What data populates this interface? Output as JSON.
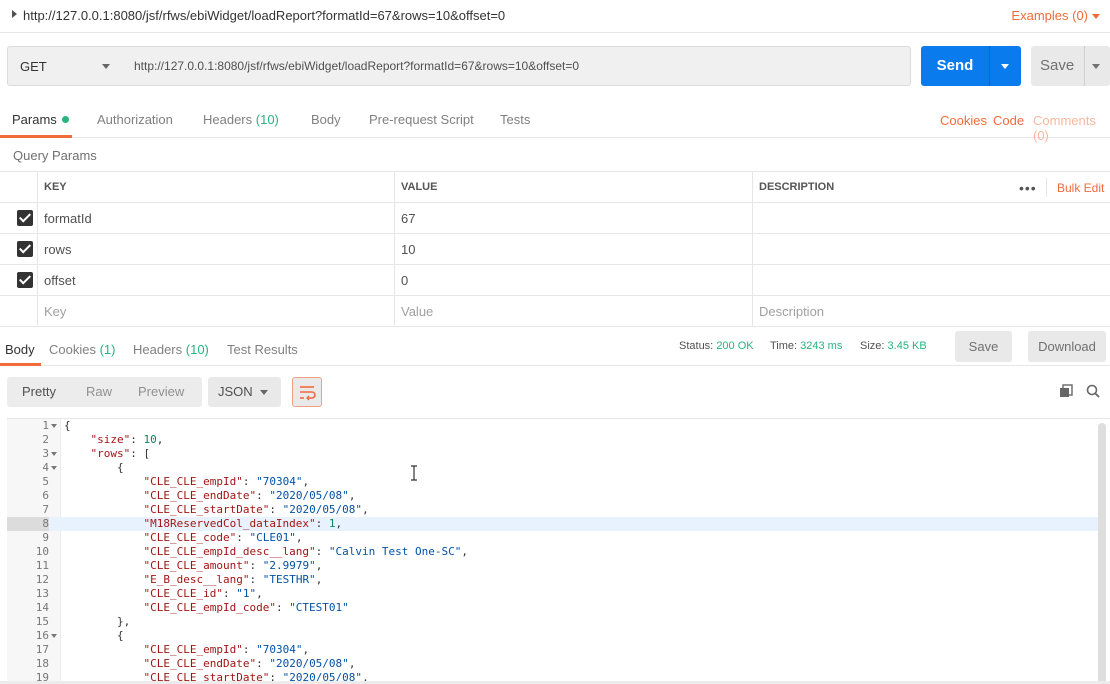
{
  "titlebar": {
    "title": "http://127.0.0.1:8080/jsf/rfws/ebiWidget/loadReport?formatId=67&rows=10&offset=0",
    "examples": "Examples (0)"
  },
  "request": {
    "method": "GET",
    "url": "http://127.0.0.1:8080/jsf/rfws/ebiWidget/loadReport?formatId=67&rows=10&offset=0",
    "send_label": "Send",
    "save_label": "Save"
  },
  "request_tabs": {
    "params": "Params",
    "authorization": "Authorization",
    "headers": "Headers",
    "headers_count": "(10)",
    "body": "Body",
    "prerequest": "Pre-request Script",
    "tests": "Tests",
    "cookies": "Cookies",
    "code": "Code",
    "comments": "Comments (0)"
  },
  "params": {
    "section_label": "Query Params",
    "columns": {
      "key": "KEY",
      "value": "VALUE",
      "description": "DESCRIPTION"
    },
    "more": "•••",
    "bulk_edit": "Bulk Edit",
    "rows": [
      {
        "key": "formatId",
        "value": "67",
        "checked": true
      },
      {
        "key": "rows",
        "value": "10",
        "checked": true
      },
      {
        "key": "offset",
        "value": "0",
        "checked": true
      }
    ],
    "placeholders": {
      "key": "Key",
      "value": "Value",
      "description": "Description"
    }
  },
  "response_tabs": {
    "body": "Body",
    "cookies": "Cookies",
    "cookies_count": "(1)",
    "headers": "Headers",
    "headers_count": "(10)",
    "test_results": "Test Results"
  },
  "response_status": {
    "status_label": "Status:",
    "status_value": "200 OK",
    "time_label": "Time:",
    "time_value": "3243 ms",
    "size_label": "Size:",
    "size_value": "3.45 KB",
    "save_label": "Save",
    "download_label": "Download"
  },
  "viewer": {
    "modes": [
      "Pretty",
      "Raw",
      "Preview"
    ],
    "format": "JSON"
  },
  "code_lines": [
    {
      "n": "1",
      "fold": true,
      "text": "{"
    },
    {
      "n": "2",
      "text": "    \"size\": 10,"
    },
    {
      "n": "3",
      "fold": true,
      "text": "    \"rows\": ["
    },
    {
      "n": "4",
      "fold": true,
      "text": "        {"
    },
    {
      "n": "5",
      "text": "            \"CLE_CLE_empId\": \"70304\","
    },
    {
      "n": "6",
      "text": "            \"CLE_CLE_endDate\": \"2020/05/08\","
    },
    {
      "n": "7",
      "text": "            \"CLE_CLE_startDate\": \"2020/05/08\","
    },
    {
      "n": "8",
      "text": "            \"M18ReservedCol_dataIndex\": 1,",
      "highlight": true
    },
    {
      "n": "9",
      "text": "            \"CLE_CLE_code\": \"CLE01\","
    },
    {
      "n": "10",
      "text": "            \"CLE_CLE_empId_desc__lang\": \"Calvin Test One-SC\","
    },
    {
      "n": "11",
      "text": "            \"CLE_CLE_amount\": \"2.9979\","
    },
    {
      "n": "12",
      "text": "            \"E_B_desc__lang\": \"TESTHR\","
    },
    {
      "n": "13",
      "text": "            \"CLE_CLE_id\": \"1\","
    },
    {
      "n": "14",
      "text": "            \"CLE_CLE_empId_code\": \"CTEST01\""
    },
    {
      "n": "15",
      "text": "        },"
    },
    {
      "n": "16",
      "fold": true,
      "text": "        {"
    },
    {
      "n": "17",
      "text": "            \"CLE_CLE_empId\": \"70304\","
    },
    {
      "n": "18",
      "text": "            \"CLE_CLE_endDate\": \"2020/05/08\","
    },
    {
      "n": "19",
      "text": "            \"CLE_CLE_startDate\": \"2020/05/08\","
    }
  ],
  "colors": {
    "accent": "#f26b3a",
    "primary": "#097bed",
    "success": "#26b47f"
  }
}
